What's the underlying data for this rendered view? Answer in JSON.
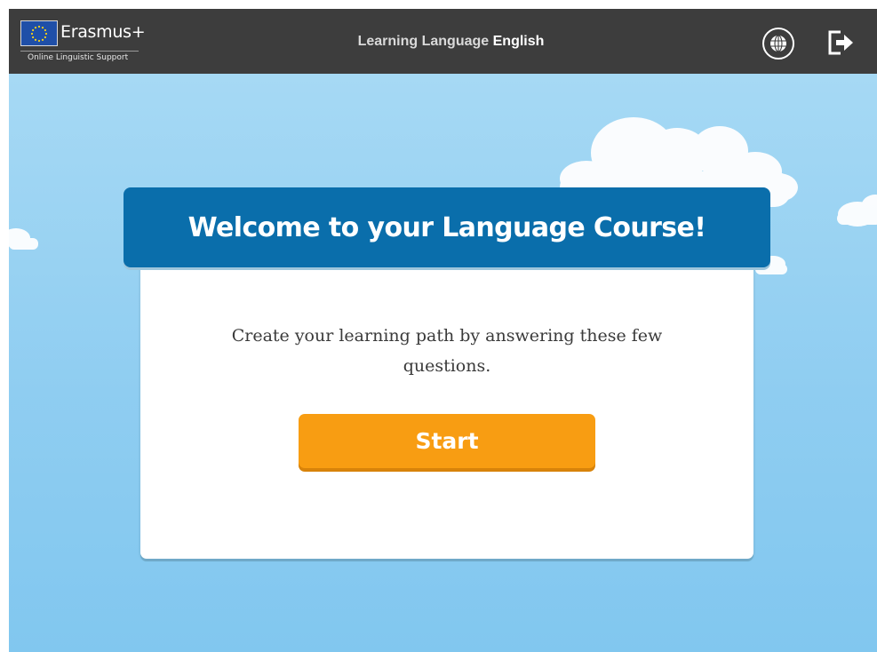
{
  "header": {
    "brand": "Erasmus+",
    "tagline": "Online Linguistic Support",
    "title_prefix": "Learning Language",
    "title_language": "English",
    "globe_icon": "globe-icon",
    "logout_icon": "logout-icon"
  },
  "welcome": {
    "heading": "Welcome to your Language Course!",
    "intro": "Create your learning path by answering these few questions.",
    "start_label": "Start"
  },
  "colors": {
    "topbar": "#3d3d3d",
    "banner": "#0a6eab",
    "start_button": "#f89d12",
    "sky": "#8fcdf1"
  }
}
